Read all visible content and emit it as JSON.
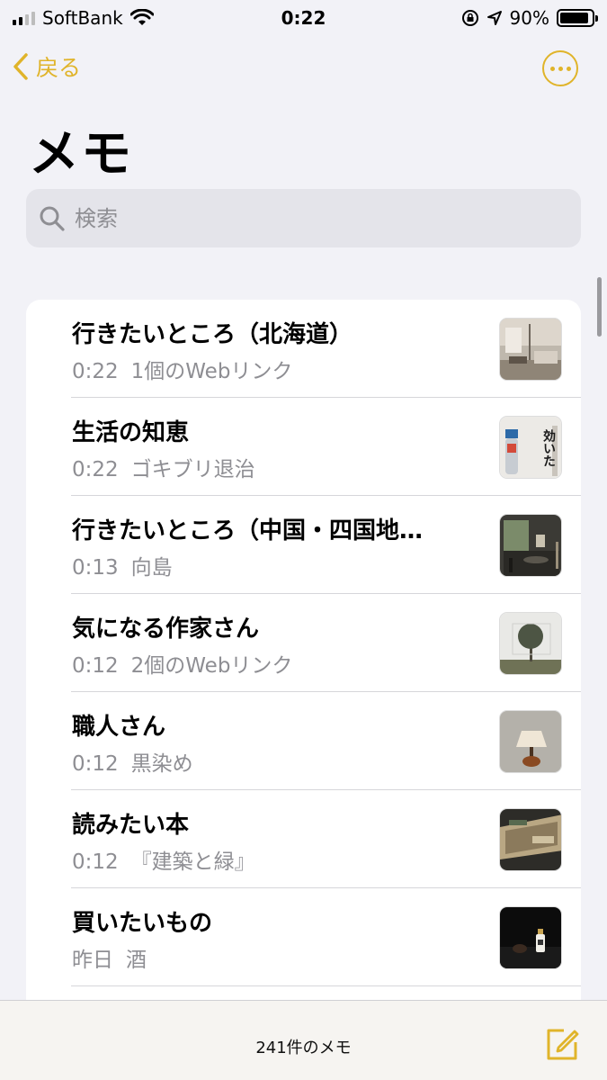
{
  "status": {
    "carrier": "SoftBank",
    "time": "0:22",
    "battery": "90%",
    "battery_level": 0.9
  },
  "nav": {
    "back_label": "戻る"
  },
  "title": "メモ",
  "search": {
    "placeholder": "検索"
  },
  "notes": [
    {
      "title": "行きたいところ（北海道）",
      "time": "0:22",
      "preview": "1個のWebリンク"
    },
    {
      "title": "生活の知恵",
      "time": "0:22",
      "preview": "ゴキブリ退治"
    },
    {
      "title": "行きたいところ（中国・四国地…",
      "time": "0:13",
      "preview": "向島"
    },
    {
      "title": "気になる作家さん",
      "time": "0:12",
      "preview": "2個のWebリンク"
    },
    {
      "title": "職人さん",
      "time": "0:12",
      "preview": "黒染め"
    },
    {
      "title": "読みたい本",
      "time": "0:12",
      "preview": "『建築と緑』"
    },
    {
      "title": "買いたいもの",
      "time": "昨日",
      "preview": "酒"
    }
  ],
  "thumb_text": "効いた",
  "footer": {
    "count": "241件のメモ"
  },
  "colors": {
    "accent": "#e0b42a",
    "background": "#f2f2f7"
  }
}
